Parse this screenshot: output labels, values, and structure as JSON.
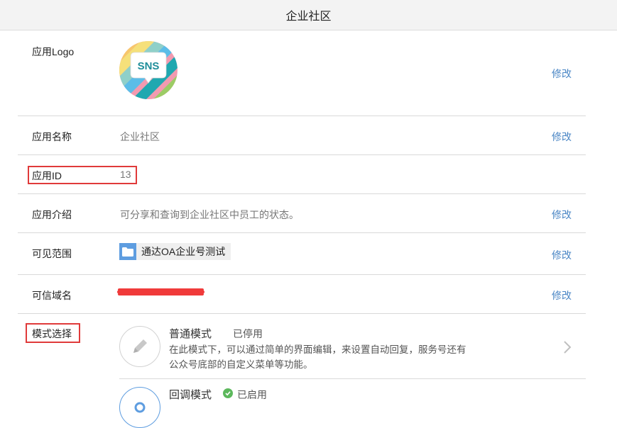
{
  "app_title": "企业社区",
  "edit_label": "修改",
  "rows": {
    "logo": {
      "label": "应用Logo",
      "logo_text": "SNS"
    },
    "name": {
      "label": "应用名称",
      "value": "企业社区"
    },
    "id": {
      "label": "应用ID",
      "value": "13"
    },
    "intro": {
      "label": "应用介绍",
      "value": "可分享和查询到企业社区中员工的状态。"
    },
    "scope": {
      "label": "可见范围",
      "chip": "通达OA企业号测试"
    },
    "domain": {
      "label": "可信域名"
    },
    "mode": {
      "label": "模式选择",
      "items": [
        {
          "name": "普通模式",
          "status": "已停用",
          "desc": "在此模式下，可以通过简单的界面编辑，来设置自动回复，服务号还有公众号底部的自定义菜单等功能。"
        },
        {
          "name": "回调模式",
          "status": "已启用"
        }
      ]
    }
  },
  "colors": {
    "link": "#4a86c5",
    "highlight": "#e03a3a",
    "enabled": "#5cb85c"
  }
}
